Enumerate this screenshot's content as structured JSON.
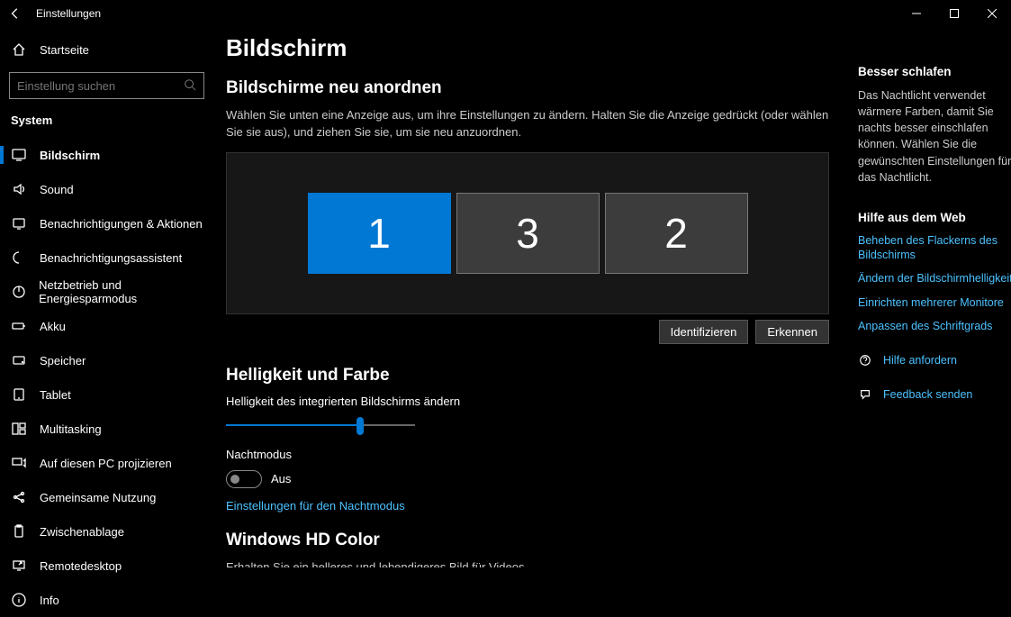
{
  "titlebar": {
    "title": "Einstellungen"
  },
  "sidebar": {
    "home": "Startseite",
    "searchPlaceholder": "Einstellung suchen",
    "section": "System",
    "items": [
      {
        "label": "Bildschirm",
        "icon": "monitor"
      },
      {
        "label": "Sound",
        "icon": "sound"
      },
      {
        "label": "Benachrichtigungen & Aktionen",
        "icon": "notifications"
      },
      {
        "label": "Benachrichtigungsassistent",
        "icon": "focus"
      },
      {
        "label": "Netzbetrieb und Energiesparmodus",
        "icon": "power"
      },
      {
        "label": "Akku",
        "icon": "battery"
      },
      {
        "label": "Speicher",
        "icon": "storage"
      },
      {
        "label": "Tablet",
        "icon": "tablet"
      },
      {
        "label": "Multitasking",
        "icon": "multitask"
      },
      {
        "label": "Auf diesen PC projizieren",
        "icon": "project"
      },
      {
        "label": "Gemeinsame Nutzung",
        "icon": "share"
      },
      {
        "label": "Zwischenablage",
        "icon": "clipboard"
      },
      {
        "label": "Remotedesktop",
        "icon": "remote"
      },
      {
        "label": "Info",
        "icon": "info"
      }
    ]
  },
  "main": {
    "pageTitle": "Bildschirm",
    "rearrange": {
      "heading": "Bildschirme neu anordnen",
      "desc": "Wählen Sie unten eine Anzeige aus, um ihre Einstellungen zu ändern. Halten Sie die Anzeige gedrückt (oder wählen Sie sie aus), und ziehen Sie sie, um sie neu anzuordnen.",
      "monitors": [
        "1",
        "3",
        "2"
      ],
      "selectedIndex": 0,
      "identifyBtn": "Identifizieren",
      "detectBtn": "Erkennen"
    },
    "brightness": {
      "heading": "Helligkeit und Farbe",
      "sliderLabel": "Helligkeit des integrierten Bildschirms ändern",
      "sliderPct": 71,
      "nightLabel": "Nachtmodus",
      "nightState": "Aus",
      "nightLink": "Einstellungen für den Nachtmodus"
    },
    "hdr": {
      "heading": "Windows HD Color",
      "desc": "Erhalten Sie ein helleres und lebendigeres Bild für Videos, Spiele und Apps, die HDR unterstützen."
    }
  },
  "right": {
    "sleep": {
      "heading": "Besser schlafen",
      "desc": "Das Nachtlicht verwendet wärmere Farben, damit Sie nachts besser einschlafen können. Wählen Sie die gewünschten Einstellungen für das Nachtlicht."
    },
    "help": {
      "heading": "Hilfe aus dem Web",
      "links": [
        "Beheben des Flackerns des Bildschirms",
        "Ändern der Bildschirmhelligkeit",
        "Einrichten mehrerer Monitore",
        "Anpassen des Schriftgrads"
      ]
    },
    "actions": {
      "help": "Hilfe anfordern",
      "feedback": "Feedback senden"
    }
  }
}
